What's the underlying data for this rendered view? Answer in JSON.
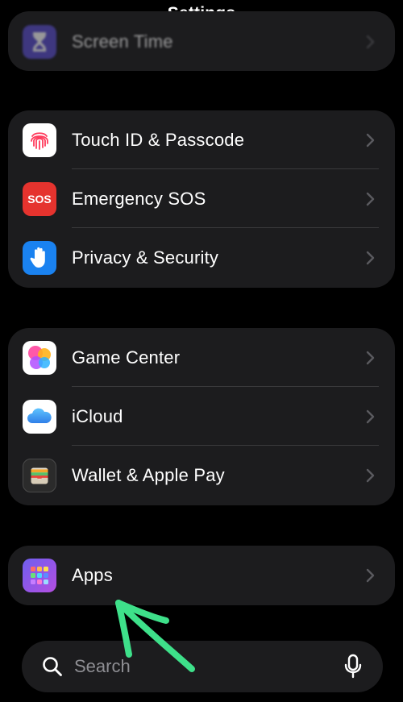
{
  "header": {
    "title": "Settings"
  },
  "groups": [
    {
      "items": [
        {
          "label": "Screen Time",
          "icon": "hourglass-icon"
        }
      ]
    },
    {
      "items": [
        {
          "label": "Touch ID & Passcode",
          "icon": "fingerprint-icon"
        },
        {
          "label": "Emergency SOS",
          "icon": "sos-icon",
          "icon_text": "SOS"
        },
        {
          "label": "Privacy & Security",
          "icon": "hand-icon"
        }
      ]
    },
    {
      "items": [
        {
          "label": "Game Center",
          "icon": "game-center-icon"
        },
        {
          "label": "iCloud",
          "icon": "cloud-icon"
        },
        {
          "label": "Wallet & Apple Pay",
          "icon": "wallet-icon"
        }
      ]
    },
    {
      "items": [
        {
          "label": "Apps",
          "icon": "apps-grid-icon"
        }
      ]
    }
  ],
  "search": {
    "placeholder": "Search"
  },
  "colors": {
    "background": "#000000",
    "cell": "#1c1c1e",
    "separator": "#3a3a3c",
    "chevron": "#5a5a5f",
    "annotation_arrow": "#3ee08a"
  }
}
